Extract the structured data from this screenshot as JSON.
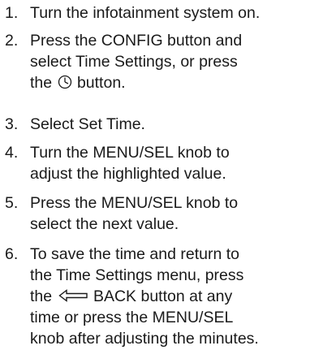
{
  "steps": [
    {
      "num": "1.",
      "text": "Turn the infotainment system on."
    },
    {
      "num": "2.",
      "line1": "Press the CONFIG button and",
      "line2": "select Time Settings, or press",
      "line3_pre": "the",
      "icon": "clock-icon",
      "line3_post": "button."
    },
    {
      "num": "3.",
      "text": "Select Set Time."
    },
    {
      "num": "4.",
      "line1": "Turn the MENU/SEL knob to",
      "line2": "adjust the highlighted value."
    },
    {
      "num": "5.",
      "line1": "Press the MENU/SEL knob to",
      "line2": "select the next value."
    },
    {
      "num": "6.",
      "line1": "To save the time and return to",
      "line2": "the Time Settings menu, press",
      "line3_pre": "the",
      "icon": "back-arrow-icon",
      "line3_post": "BACK button at any",
      "line4": "time or press the MENU/SEL",
      "line5": "knob after adjusting the minutes."
    }
  ]
}
